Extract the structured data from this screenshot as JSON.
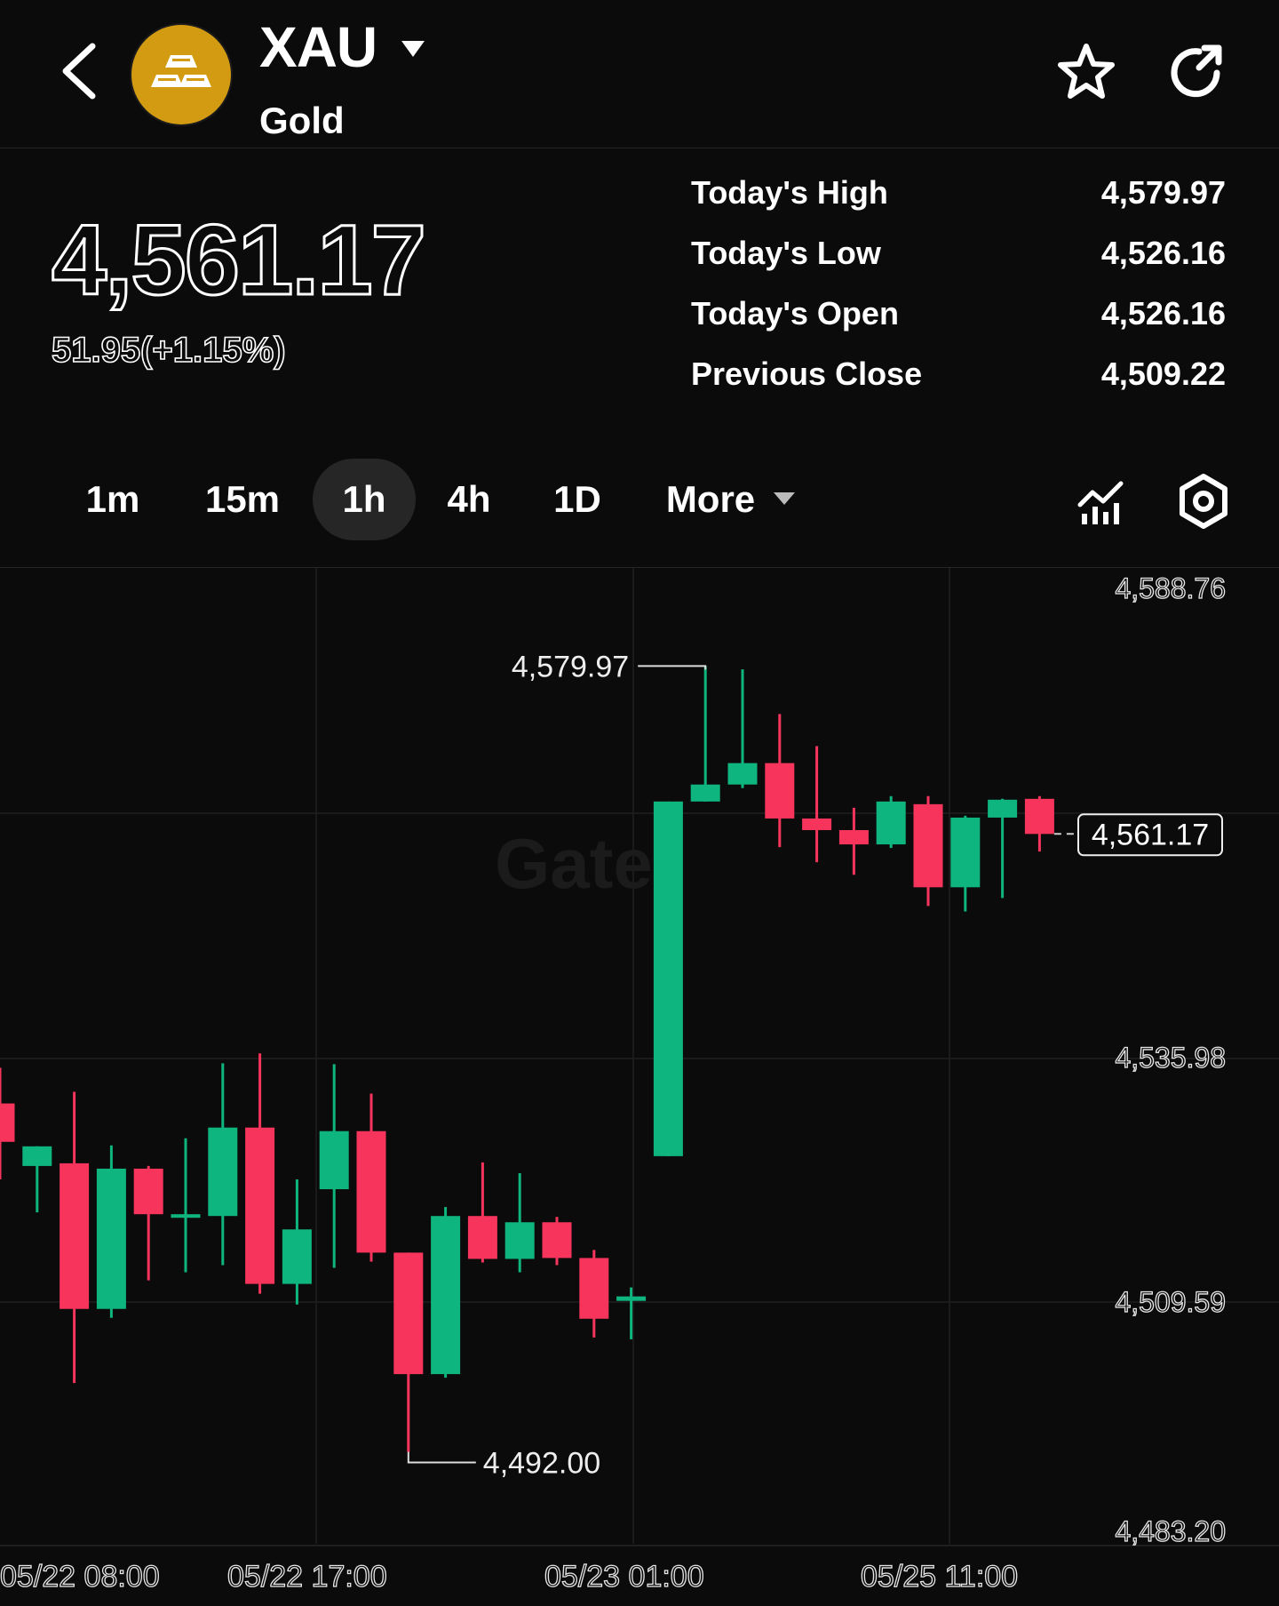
{
  "header": {
    "symbol": "XAU",
    "name": "Gold"
  },
  "quote": {
    "price": "4,561.17",
    "change": "51.95(+1.15%)"
  },
  "stats": [
    {
      "label": "Today's High",
      "value": "4,579.97"
    },
    {
      "label": "Today's Low",
      "value": "4,526.16"
    },
    {
      "label": "Today's Open",
      "value": "4,526.16"
    },
    {
      "label": "Previous Close",
      "value": "4,509.22"
    }
  ],
  "tabs": [
    "1m",
    "15m",
    "1h",
    "4h",
    "1D",
    "More"
  ],
  "active_tab": "1h",
  "icons": [
    "back-icon",
    "gold-bars-icon",
    "caret-down-icon",
    "star-icon",
    "share-icon",
    "indicator-icon",
    "settings-icon"
  ],
  "colors": {
    "up": "#0fb57e",
    "down": "#f6345c",
    "gold": "#d39b12",
    "background": "#0b0b0b"
  },
  "chart_data": {
    "type": "candlestick",
    "y_ticks": [
      "4,588.76",
      "4,535.98",
      "4,509.59",
      "4,483.20"
    ],
    "x_ticks": [
      "05/22 08:00",
      "05/22 17:00",
      "05/23 01:00",
      "05/25 11:00"
    ],
    "high_marker": "4,579.97",
    "low_marker": "4,492.00",
    "last_price_label": "4,561.17",
    "watermark": "Gate",
    "candles": [
      {
        "o": 4531.0,
        "h": 4535.0,
        "l": 4522.5,
        "c": 4526.7
      },
      {
        "o": 4524.0,
        "h": 4522.0,
        "l": 4518.8,
        "c": 4526.2
      },
      {
        "o": 4524.3,
        "h": 4532.3,
        "l": 4499.7,
        "c": 4508.0
      },
      {
        "o": 4508.0,
        "h": 4526.3,
        "l": 4507.0,
        "c": 4523.7
      },
      {
        "o": 4523.7,
        "h": 4524.0,
        "l": 4511.2,
        "c": 4518.6
      },
      {
        "o": 4518.6,
        "h": 4527.1,
        "l": 4512.1,
        "c": 4518.6
      },
      {
        "o": 4518.4,
        "h": 4535.5,
        "l": 4512.9,
        "c": 4528.3
      },
      {
        "o": 4528.3,
        "h": 4536.6,
        "l": 4509.7,
        "c": 4510.8
      },
      {
        "o": 4510.8,
        "h": 4522.5,
        "l": 4508.5,
        "c": 4516.9
      },
      {
        "o": 4521.4,
        "h": 4535.4,
        "l": 4512.6,
        "c": 4527.9
      },
      {
        "o": 4527.9,
        "h": 4532.1,
        "l": 4513.3,
        "c": 4514.3
      },
      {
        "o": 4514.3,
        "h": 4514.3,
        "l": 4492.0,
        "c": 4500.7
      },
      {
        "o": 4500.7,
        "h": 4519.4,
        "l": 4500.3,
        "c": 4518.4
      },
      {
        "o": 4518.4,
        "h": 4524.4,
        "l": 4513.2,
        "c": 4513.6
      },
      {
        "o": 4513.6,
        "h": 4523.2,
        "l": 4512.1,
        "c": 4517.7
      },
      {
        "o": 4517.7,
        "h": 4518.3,
        "l": 4512.9,
        "c": 4513.7
      },
      {
        "o": 4513.7,
        "h": 4514.6,
        "l": 4504.8,
        "c": 4506.9
      },
      {
        "o": 4508.9,
        "h": 4510.4,
        "l": 4504.6,
        "c": 4509.4
      },
      {
        "o": 4525.1,
        "h": 4564.8,
        "l": 4525.1,
        "c": 4564.8
      },
      {
        "o": 4564.8,
        "h": 4579.97,
        "l": 4564.8,
        "c": 4566.7
      },
      {
        "o": 4566.7,
        "h": 4579.6,
        "l": 4566.3,
        "c": 4569.1
      },
      {
        "o": 4569.1,
        "h": 4574.6,
        "l": 4559.7,
        "c": 4562.9
      },
      {
        "o": 4562.9,
        "h": 4571.0,
        "l": 4558.0,
        "c": 4561.6
      },
      {
        "o": 4561.6,
        "h": 4564.1,
        "l": 4556.6,
        "c": 4560.0
      },
      {
        "o": 4560.0,
        "h": 4565.4,
        "l": 4559.6,
        "c": 4564.8
      },
      {
        "o": 4564.5,
        "h": 4565.4,
        "l": 4553.1,
        "c": 4555.2
      },
      {
        "o": 4555.2,
        "h": 4563.2,
        "l": 4552.5,
        "c": 4563.0
      },
      {
        "o": 4563.0,
        "h": 4565.1,
        "l": 4554.0,
        "c": 4565.0
      },
      {
        "o": 4565.1,
        "h": 4565.4,
        "l": 4559.2,
        "c": 4561.17
      }
    ]
  }
}
